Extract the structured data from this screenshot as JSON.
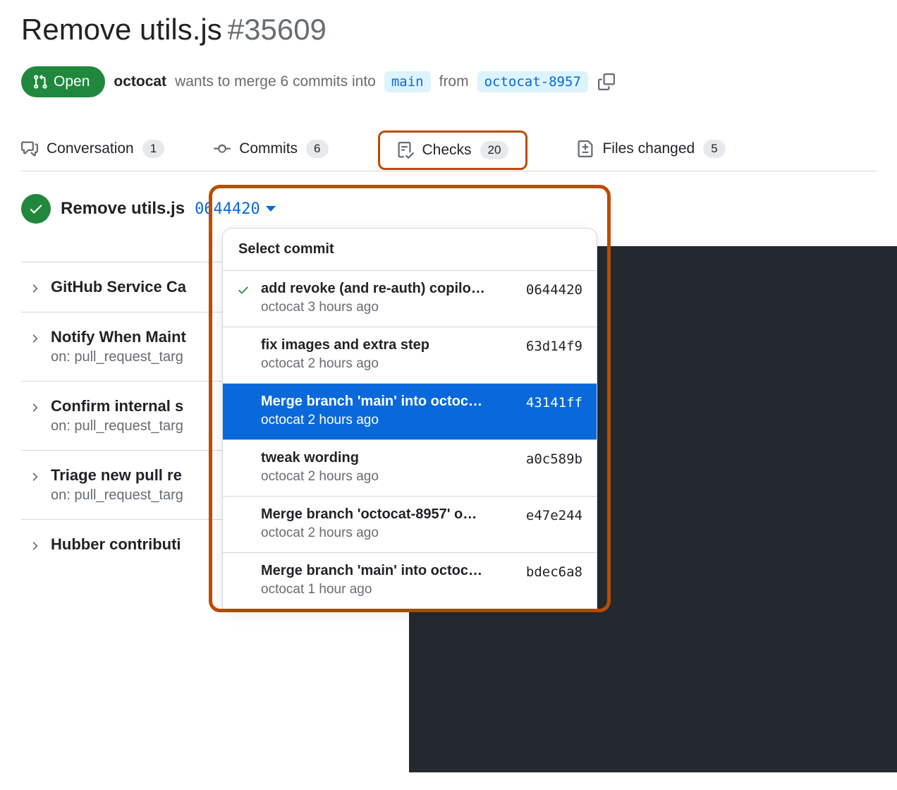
{
  "pr": {
    "title": "Remove utils.js",
    "number": "#35609",
    "state_label": "Open",
    "author": "octocat",
    "merge_text_a": "wants to merge 6 commits into",
    "base_branch": "main",
    "merge_text_b": "from",
    "head_branch": "octocat-8957"
  },
  "tabs": {
    "conversation": {
      "label": "Conversation",
      "count": "1"
    },
    "commits": {
      "label": "Commits",
      "count": "6"
    },
    "checks": {
      "label": "Checks",
      "count": "20"
    },
    "files": {
      "label": "Files changed",
      "count": "5"
    }
  },
  "checks_header": {
    "title": "Remove utils.js",
    "sha": "0644420"
  },
  "check_list": [
    {
      "title": "GitHub Service Ca",
      "sub": null
    },
    {
      "title": "Notify When Maint",
      "sub": "on: pull_request_targ"
    },
    {
      "title": "Confirm internal s",
      "sub": "on: pull_request_targ"
    },
    {
      "title": "Triage new pull re",
      "sub": "on: pull_request_targ"
    },
    {
      "title": "Hubber contributi",
      "sub": null
    }
  ],
  "dropdown": {
    "heading": "Select commit",
    "items": [
      {
        "msg": "add revoke (and re-auth) copilo…",
        "author": "octocat",
        "time": "3 hours ago",
        "sha": "0644420",
        "checked": true,
        "selected": false
      },
      {
        "msg": "fix images and extra step",
        "author": "octocat",
        "time": "2 hours ago",
        "sha": "63d14f9",
        "checked": false,
        "selected": false
      },
      {
        "msg": "Merge branch 'main' into octoc…",
        "author": "octocat",
        "time": "2 hours ago",
        "sha": "43141ff",
        "checked": false,
        "selected": true
      },
      {
        "msg": "tweak wording",
        "author": "octocat",
        "time": "2 hours ago",
        "sha": "a0c589b",
        "checked": false,
        "selected": false
      },
      {
        "msg": "Merge branch 'octocat-8957' o…",
        "author": "octocat",
        "time": "2 hours ago",
        "sha": "e47e244",
        "checked": false,
        "selected": false
      },
      {
        "msg": "Merge branch 'main' into octoc…",
        "author": "octocat",
        "time": "1 hour ago",
        "sha": "bdec6a8",
        "checked": false,
        "selected": false
      }
    ]
  }
}
